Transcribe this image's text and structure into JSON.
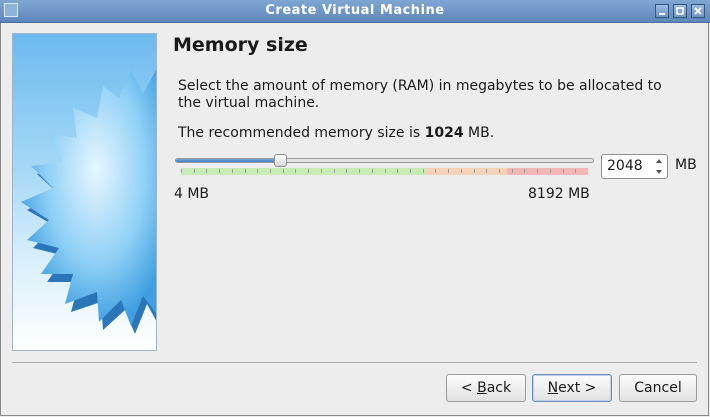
{
  "window": {
    "title": "Create Virtual Machine"
  },
  "page": {
    "title": "Memory size",
    "description": "Select the amount of memory (RAM) in megabytes to be allocated to the virtual machine.",
    "recommended_prefix": "The recommended memory size is ",
    "recommended_value": "1024",
    "recommended_suffix": " MB."
  },
  "memory": {
    "value": "2048",
    "unit": "MB",
    "min_label": "4 MB",
    "max_label": "8192 MB",
    "min_mb": 4,
    "max_mb": 8192,
    "current_mb": 2048,
    "recommended_mb": 1024,
    "green_until_mb": 4915,
    "orange_until_mb": 6554
  },
  "buttons": {
    "back_mnemonic": "B",
    "back_rest": "ack",
    "back_prefix": "< ",
    "next_mnemonic": "N",
    "next_rest": "ext >",
    "cancel": "Cancel"
  },
  "colors": {
    "titlebar": "#6f96c6",
    "slider_fill": "#3d7cc8",
    "green_zone": "#c7ecb6",
    "orange_zone": "#f5d2b8",
    "red_zone": "#f3b6b6"
  },
  "icons": {
    "app": "virtualbox-window-icon",
    "minimize": "minimize-icon",
    "maximize": "maximize-icon",
    "close": "close-icon",
    "spin_up": "spin-up-arrow-icon",
    "spin_down": "spin-down-arrow-icon"
  }
}
